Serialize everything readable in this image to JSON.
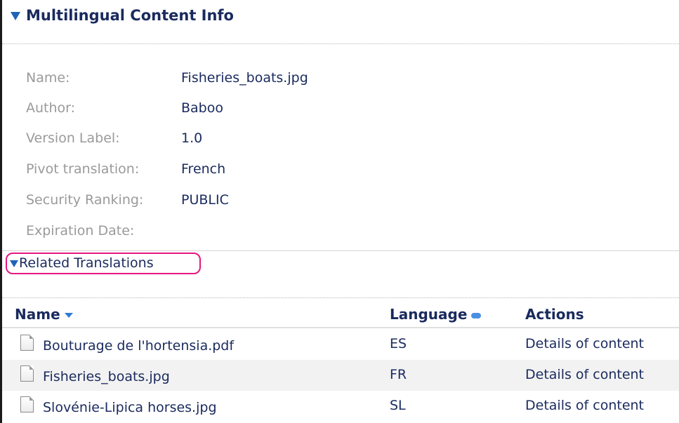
{
  "header": {
    "title": "Multilingual Content Info"
  },
  "info": {
    "rows": [
      {
        "label": "Name:",
        "value": "Fisheries_boats.jpg"
      },
      {
        "label": "Author:",
        "value": "Baboo"
      },
      {
        "label": "Version Label:",
        "value": "1.0"
      },
      {
        "label": "Pivot translation:",
        "value": "French"
      },
      {
        "label": "Security Ranking:",
        "value": "PUBLIC"
      },
      {
        "label": "Expiration Date:",
        "value": ""
      }
    ]
  },
  "related": {
    "label": "Related Translations"
  },
  "table": {
    "columns": [
      "Name",
      "Language",
      "Actions"
    ],
    "rows": [
      {
        "name": "Bouturage de l'hortensia.pdf",
        "language": "ES",
        "action": "Details of content"
      },
      {
        "name": "Fisheries_boats.jpg",
        "language": "FR",
        "action": "Details of content"
      },
      {
        "name": "Slovénie-Lipica horses.jpg",
        "language": "SL",
        "action": "Details of content"
      }
    ]
  },
  "colors": {
    "accent": "#1e63b8",
    "highlight_outline": "#e5177f",
    "text_dark": "#1a2a5e",
    "label_gray": "#9a9a9a"
  }
}
